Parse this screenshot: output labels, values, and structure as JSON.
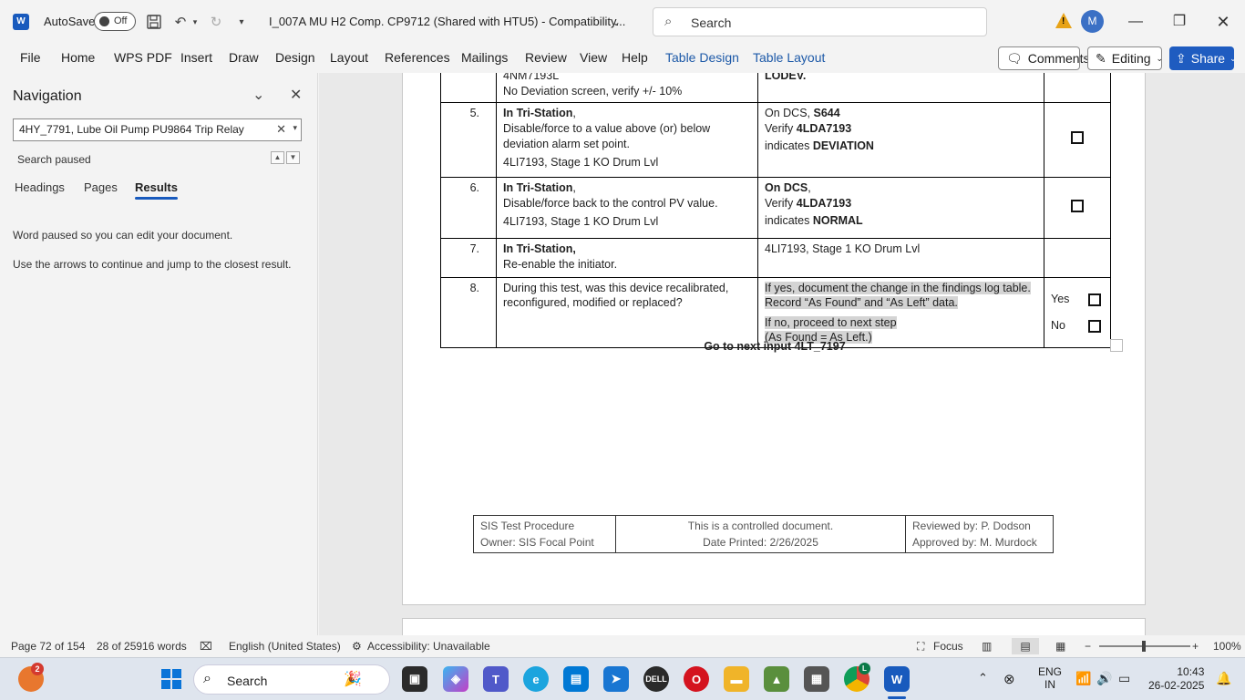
{
  "titlebar": {
    "app_icon": "word-icon",
    "autosave_label": "AutoSave",
    "autosave_state": "Off",
    "doc_title": "I_007A MU H2 Comp. CP9712 (Shared with HTU5)  -  Compatibility...",
    "search_placeholder": "Search",
    "avatar_initial": "M"
  },
  "ribbon": {
    "tabs": [
      "File",
      "Home",
      "WPS PDF",
      "Insert",
      "Draw",
      "Design",
      "Layout",
      "References",
      "Mailings",
      "Review",
      "View",
      "Help",
      "Table Design",
      "Table Layout"
    ],
    "comments_label": "Comments",
    "editing_label": "Editing",
    "share_label": "Share"
  },
  "navigation": {
    "title": "Navigation",
    "search_value": "4HY_7791, Lube Oil Pump PU9864 Trip Relay",
    "status": "Search paused",
    "tabs": [
      "Headings",
      "Pages",
      "Results"
    ],
    "active_tab": "Results",
    "message1": "Word paused so you can edit your document.",
    "message2": "Use the arrows to continue and jump to the closest result."
  },
  "document": {
    "partial_row": {
      "c2_line1": "4NM7193L",
      "c2_line2": "No Deviation screen, verify +/- 10%",
      "c3_line1": "LODEV."
    },
    "rows": [
      {
        "num": "5.",
        "c2_bold": "In Tri-Station",
        "c2_after": ",",
        "c2_body": "Disable/force to a value above (or) below deviation alarm set point.",
        "c2_tag": "4LI7193, Stage 1 KO Drum Lvl",
        "c3_line1_pre": "On DCS, ",
        "c3_line1_bold": "S644",
        "c3_line2_pre": "Verify ",
        "c3_line2_bold": "4LDA7193",
        "c3_line3_pre": " indicates ",
        "c3_line3_bold": "DEVIATION"
      },
      {
        "num": "6.",
        "c2_bold": "In Tri-Station",
        "c2_after": ",",
        "c2_body": "Disable/force back to the control PV value.",
        "c2_tag": "4LI7193, Stage 1 KO Drum Lvl",
        "c3_line1_pre": "",
        "c3_line1_bold": "On DCS",
        "c3_line1_after": ",",
        "c3_line2_pre": "Verify ",
        "c3_line2_bold": "4LDA7193",
        "c3_line3_pre": " indicates ",
        "c3_line3_bold": "NORMAL"
      }
    ],
    "row7": {
      "num": "7.",
      "c2_bold": "In Tri-Station,",
      "c2_body": "Re-enable the initiator.",
      "c3": "4LI7193, Stage 1 KO Drum Lvl"
    },
    "row8": {
      "num": "8.",
      "c2": "During this test, was this device recalibrated, reconfigured, modified or replaced?",
      "c3_a": "If yes, document the change in the findings log table. Record “As Found” and “As Left” data.",
      "c3_b1": "If no, proceed to next step",
      "c3_b2": "(As Found = As Left.)",
      "yes": "Yes",
      "no": "No"
    },
    "go_next": "Go to next input 4LT_7197",
    "footer": {
      "left1": "SIS Test Procedure",
      "left2": "Owner: SIS Focal Point",
      "mid1": "This is a controlled document.",
      "mid2": "Date Printed: 2/26/2025",
      "right1": "Reviewed by: P. Dodson",
      "right2": "Approved by: M. Murdock"
    }
  },
  "statusbar": {
    "page": "Page 72 of 154",
    "words": "28 of 25916 words",
    "language": "English (United States)",
    "accessibility": "Accessibility: Unavailable",
    "focus": "Focus",
    "zoom": "100%",
    "zoom_level_percent": 100
  },
  "taskbar": {
    "search_placeholder": "Search",
    "widgets_badge": "2",
    "chrome_badge": "L",
    "lang_line1": "ENG",
    "lang_line2": "IN",
    "time": "10:43",
    "date": "26-02-2025"
  },
  "colors": {
    "accent": "#185abd",
    "share": "#1f5cc0",
    "highlight": "#d4d4d4"
  }
}
